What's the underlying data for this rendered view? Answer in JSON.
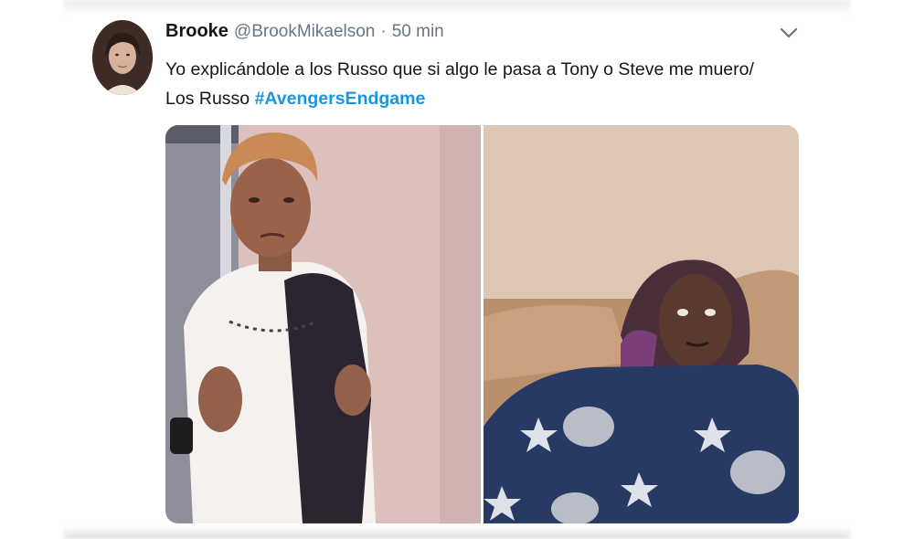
{
  "tweet": {
    "author_name": "Brooke",
    "handle": "@BrookMikaelson",
    "separator": "·",
    "time": "50 min",
    "text": "Yo explicándole a los Russo que si algo le pasa a Tony o Steve me muero/ Los Russo ",
    "hashtag": "#AvengersEndgame"
  },
  "icons": {
    "menu": "chevron-down-icon"
  },
  "colors": {
    "name": "#14171a",
    "meta": "#657786",
    "hashtag": "#1b95e0"
  }
}
